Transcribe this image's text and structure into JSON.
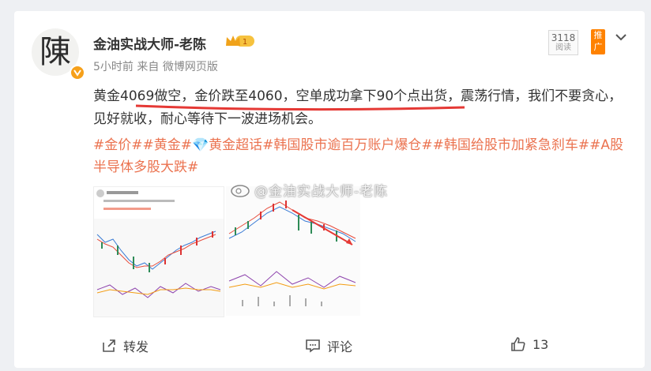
{
  "post": {
    "author": "金油实战大师-老陈",
    "level": "1",
    "time": "5小时前",
    "source_prefix": "来自",
    "source": "微博网页版",
    "read_count": "3118",
    "read_label": "阅读",
    "promote": "推广",
    "text": "黄金4069做空，金价跌至4060，空单成功拿下90个点出货，震荡行情，我们不要贪心，见好就收，耐心等待下一波进场机会。",
    "tags": "#金价##黄金#💎黄金超话#韩国股市逾百万账户爆仓##韩国给股市加紧急刹车##A股半导体多股大跌#",
    "watermark": "@金油实战大师-老陈"
  },
  "actions": {
    "repost": "转发",
    "comment": "评论",
    "like_count": "13"
  },
  "colors": {
    "tag": "#eb7350",
    "underline": "#e53935",
    "badge": "#f6a01a",
    "promote": "#ff8200"
  }
}
